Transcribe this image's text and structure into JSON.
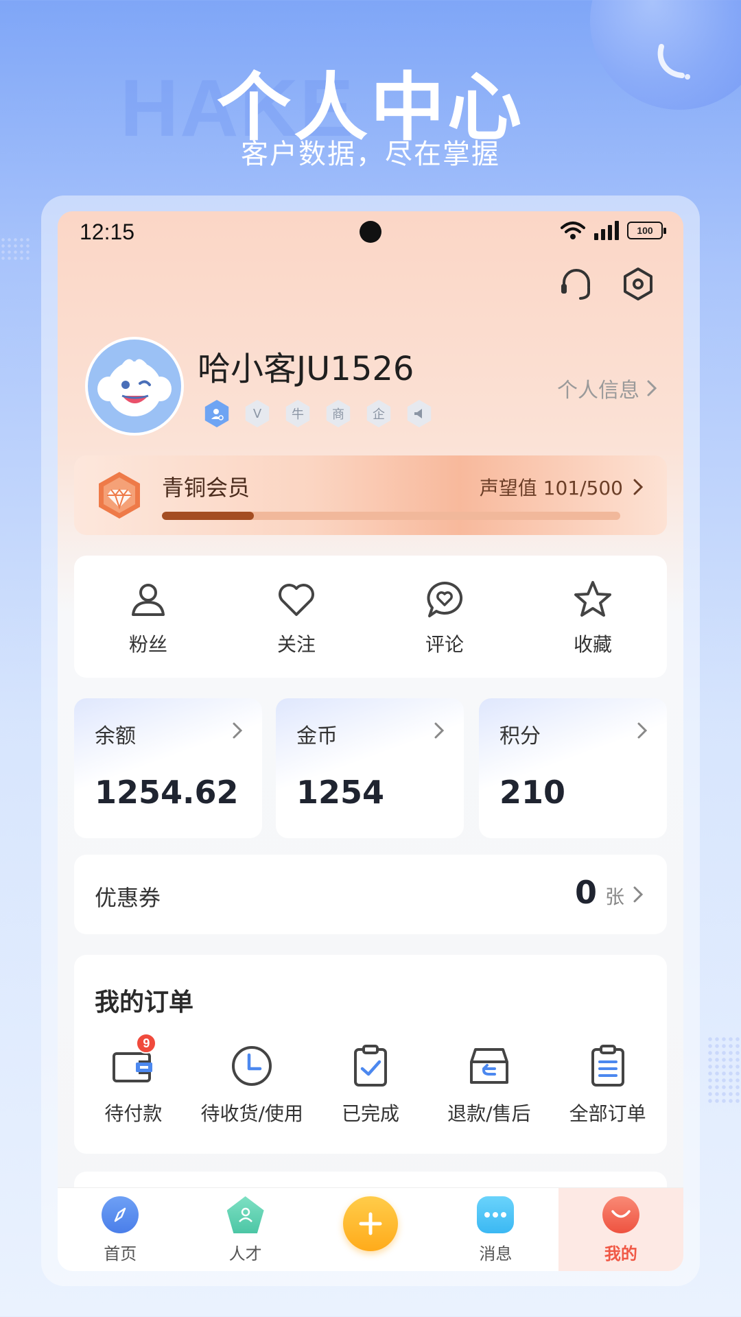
{
  "hero": {
    "bg_word": "HAKE",
    "title": "个人中心",
    "subtitle": "客户数据，尽在掌握"
  },
  "status_bar": {
    "time": "12:15",
    "battery": "100"
  },
  "profile": {
    "username": "哈小客JU1526",
    "link_label": "个人信息",
    "badges": [
      "",
      "V",
      "牛",
      "商",
      "企",
      ""
    ]
  },
  "member": {
    "level": "青铜会员",
    "reputation_label": "声望值 101/500",
    "progress": 0.2
  },
  "quick": [
    {
      "label": "粉丝",
      "icon": "user-icon"
    },
    {
      "label": "关注",
      "icon": "heart-icon"
    },
    {
      "label": "评论",
      "icon": "comment-heart-icon"
    },
    {
      "label": "收藏",
      "icon": "star-icon"
    }
  ],
  "assets": [
    {
      "label": "余额",
      "value": "1254.62"
    },
    {
      "label": "金币",
      "value": "1254"
    },
    {
      "label": "积分",
      "value": "210"
    }
  ],
  "coupon": {
    "label": "优惠券",
    "count": "0",
    "unit": "张"
  },
  "orders": {
    "title": "我的订单",
    "items": [
      {
        "label": "待付款",
        "badge": "9",
        "icon": "wallet-icon"
      },
      {
        "label": "待收货/使用",
        "icon": "clock-icon"
      },
      {
        "label": "已完成",
        "icon": "clipboard-check-icon"
      },
      {
        "label": "退款/售后",
        "icon": "return-box-icon"
      },
      {
        "label": "全部订单",
        "icon": "clipboard-list-icon"
      }
    ]
  },
  "tabs": [
    {
      "label": "首页",
      "icon": "compass-icon",
      "color": "#5b8ef0"
    },
    {
      "label": "人才",
      "icon": "talent-icon",
      "color": "#5fd0b0"
    },
    {
      "label": "",
      "icon": "plus-icon",
      "color": "#ffb52b"
    },
    {
      "label": "消息",
      "icon": "chat-icon",
      "color": "#4cc3f7"
    },
    {
      "label": "我的",
      "icon": "smile-icon",
      "color": "#f2614e"
    }
  ],
  "colors": {
    "accent": "#f05845",
    "brand_blue": "#7fa6f7",
    "member_bar": "#a44d22"
  }
}
